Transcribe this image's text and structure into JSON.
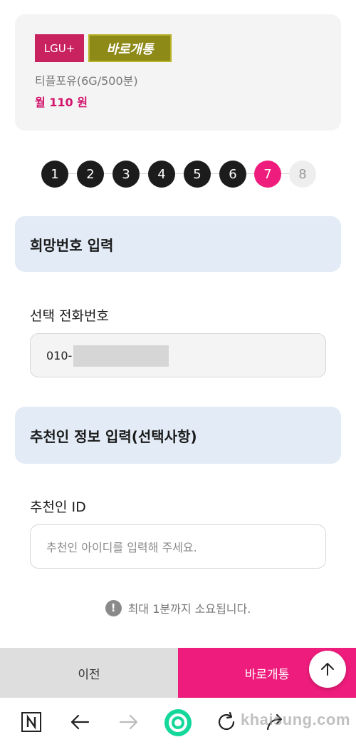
{
  "plan": {
    "carrier": "LGU+",
    "type": "바로개통",
    "name": "티플포유(6G/500분)",
    "price": "월 110 원"
  },
  "steps": [
    "1",
    "2",
    "3",
    "4",
    "5",
    "6",
    "7",
    "8"
  ],
  "current_step": 7,
  "sections": {
    "number": {
      "title": "희망번호 입력",
      "label": "선택 전화번호",
      "value": "010-"
    },
    "referrer": {
      "title": "추천인 정보 입력(선택사항)",
      "label": "추천인 ID",
      "placeholder": "추천인 아이디를 입력해 주세요."
    }
  },
  "notice": {
    "icon": "!",
    "text": "최대 1분까지 소요됩니다."
  },
  "buttons": {
    "prev": "이전",
    "open": "바로개통"
  },
  "browser_nav": [
    "naver-icon",
    "back-arrow-icon",
    "forward-arrow-icon",
    "home-circle-icon",
    "refresh-icon",
    "share-icon"
  ],
  "watermark": "khaisung.com",
  "colors": {
    "accent": "#ee1c7c",
    "carrier_badge": "#c8235f",
    "type_badge": "#8e8a18",
    "section_bg": "#e2ebf6"
  }
}
